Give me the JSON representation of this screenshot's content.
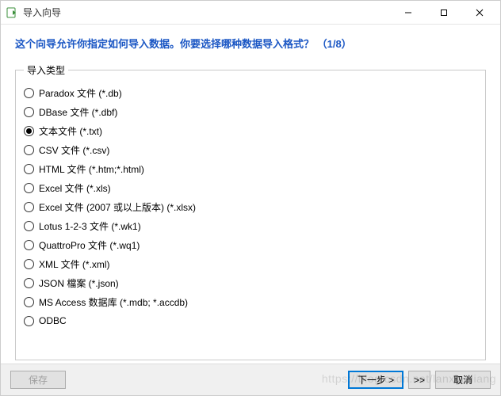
{
  "window": {
    "title": "导入向导"
  },
  "header": {
    "question": "这个向导允许你指定如何导入数据。你要选择哪种数据导入格式？ （1/8）"
  },
  "group": {
    "legend": "导入类型",
    "options": [
      {
        "label": "Paradox 文件 (*.db)",
        "checked": false
      },
      {
        "label": "DBase 文件 (*.dbf)",
        "checked": false
      },
      {
        "label": "文本文件 (*.txt)",
        "checked": true
      },
      {
        "label": "CSV 文件 (*.csv)",
        "checked": false
      },
      {
        "label": "HTML 文件 (*.htm;*.html)",
        "checked": false
      },
      {
        "label": "Excel 文件 (*.xls)",
        "checked": false
      },
      {
        "label": "Excel 文件 (2007 或以上版本) (*.xlsx)",
        "checked": false
      },
      {
        "label": "Lotus 1-2-3 文件 (*.wk1)",
        "checked": false
      },
      {
        "label": "QuattroPro 文件 (*.wq1)",
        "checked": false
      },
      {
        "label": "XML 文件 (*.xml)",
        "checked": false
      },
      {
        "label": "JSON 檔案 (*.json)",
        "checked": false
      },
      {
        "label": "MS Access 数据库 (*.mdb; *.accdb)",
        "checked": false
      },
      {
        "label": "ODBC",
        "checked": false
      }
    ]
  },
  "footer": {
    "save": "保存",
    "next": "下一步 >",
    "skip": ">>",
    "cancel": "取消"
  },
  "watermark": "https://blog.csdn.net/lanxiaoliang"
}
